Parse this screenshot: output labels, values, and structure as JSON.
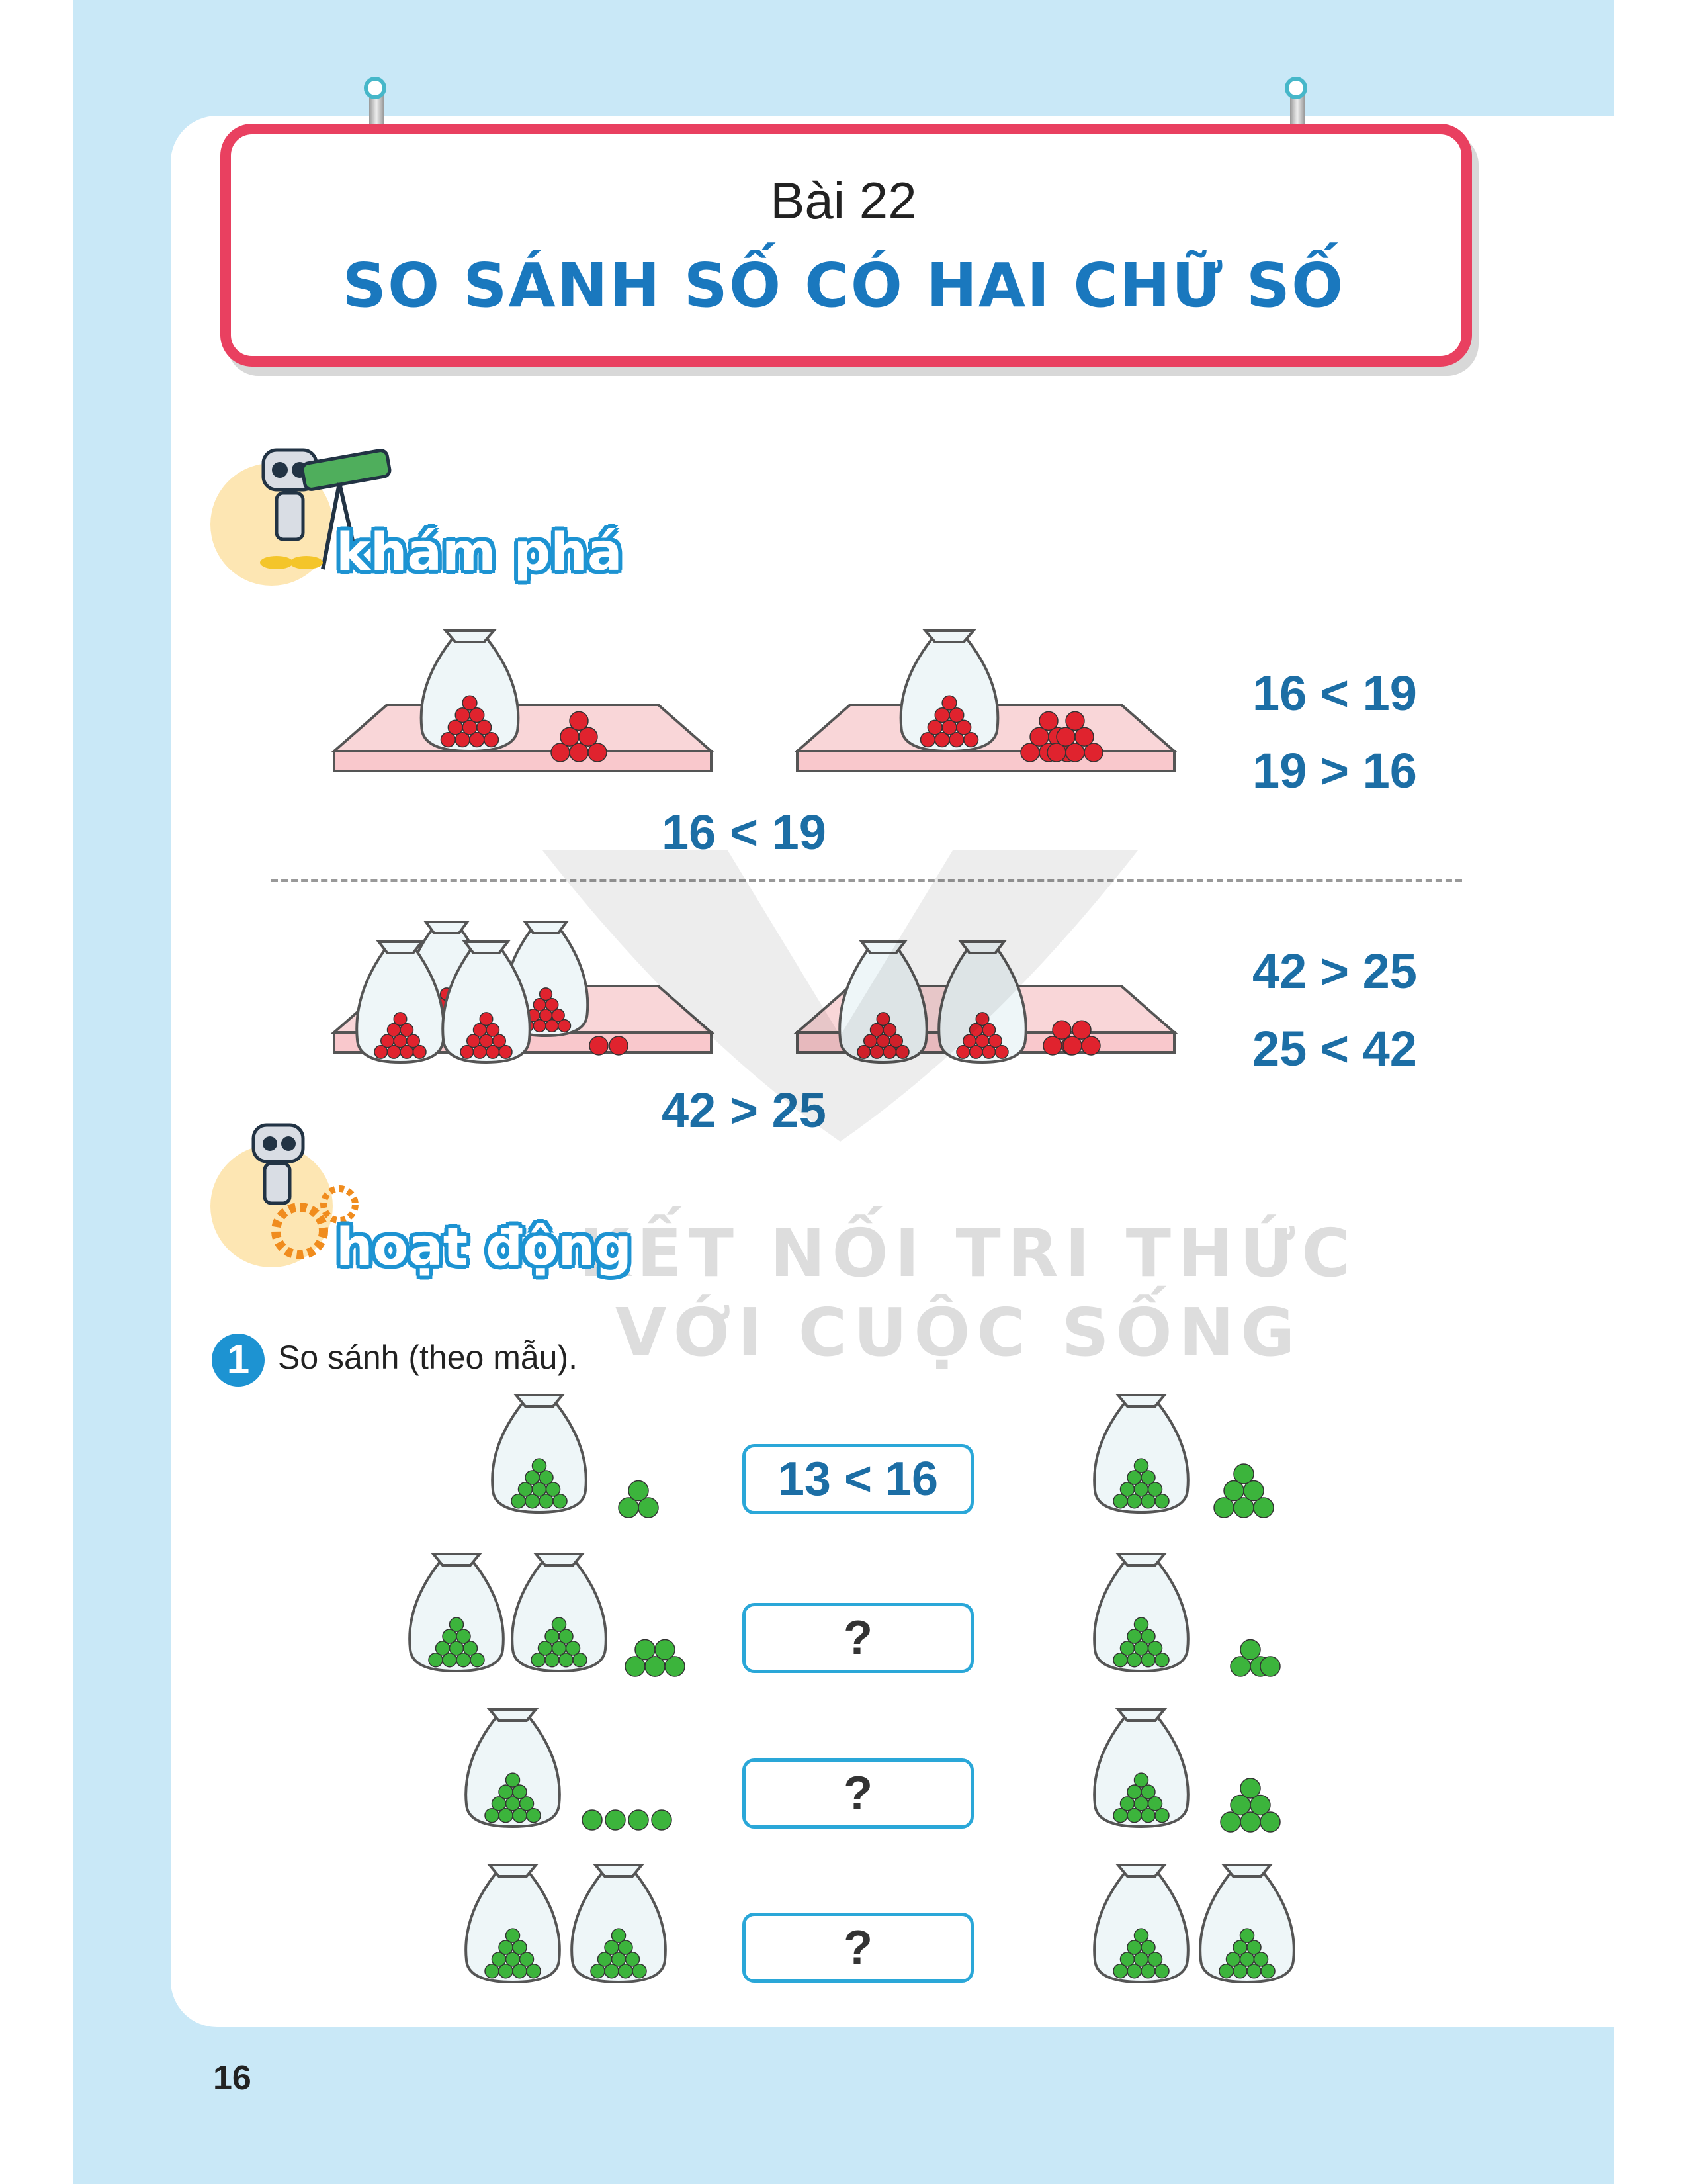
{
  "lesson": {
    "number_label": "Bài 22",
    "title": "SO SÁNH SỐ CÓ HAI CHỮ SỐ"
  },
  "sections": {
    "explore": "khám phá",
    "activity": "hoạt động"
  },
  "explore": {
    "row1": {
      "caption": "16 < 19",
      "side_a": "16 < 19",
      "side_b": "19 > 16"
    },
    "row2": {
      "caption": "42 > 25",
      "side_a": "42 > 25",
      "side_b": "25 < 42"
    }
  },
  "watermark": {
    "line1": "KẾT NỐI TRI THỨC",
    "line2": "VỚI CUỘC SỐNG"
  },
  "task1": {
    "number": "1",
    "instruction": "So sánh (theo mẫu).",
    "answers": [
      "13 < 16",
      "?",
      "?",
      "?"
    ]
  },
  "page_number": "16",
  "colors": {
    "accent_blue": "#1d93d2",
    "title_red": "#e94060",
    "apple_red": "#e0232e",
    "apple_green": "#3cb43c",
    "bg_blue": "#c9e8f7"
  },
  "icons": [
    "robot-telescope-icon",
    "robot-gears-icon",
    "apple-bag-icon",
    "tray-icon"
  ]
}
